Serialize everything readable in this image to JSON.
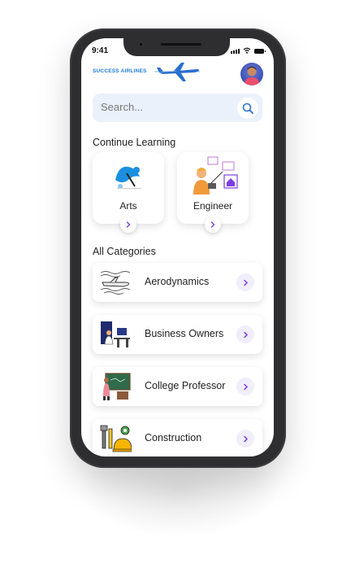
{
  "status_bar": {
    "time": "9:41"
  },
  "header": {
    "brand": "SUCCESS AIRLINES"
  },
  "search": {
    "placeholder": "Search..."
  },
  "continue_learning": {
    "title": "Continue Learning",
    "items": [
      {
        "label": "Arts",
        "icon": "arts-illustration"
      },
      {
        "label": "Engineer",
        "icon": "engineer-illustration"
      }
    ]
  },
  "all_categories": {
    "title": "All Categories",
    "items": [
      {
        "label": "Aerodynamics",
        "icon": "airplane-sketch-icon"
      },
      {
        "label": "Business Owners",
        "icon": "office-desk-icon"
      },
      {
        "label": "College Professor",
        "icon": "chalkboard-teacher-icon"
      },
      {
        "label": "Construction",
        "icon": "tools-hardhat-icon"
      }
    ]
  },
  "colors": {
    "accent": "#7b3fe4",
    "brand": "#1e7bd8",
    "search_bg": "#eaf1fb",
    "phone": "#2e2e30"
  }
}
